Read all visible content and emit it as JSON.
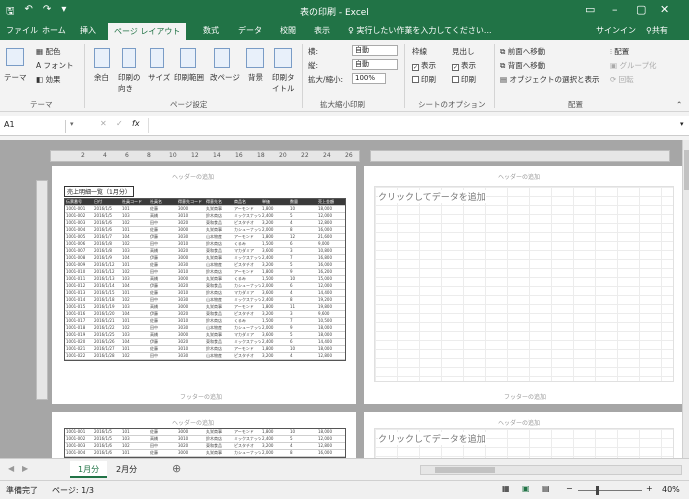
{
  "titlebar": {
    "title": "表の印刷 - Excel",
    "signin": "サインイン",
    "share": "共有"
  },
  "tabs": [
    {
      "label": "ファイル"
    },
    {
      "label": "ホーム"
    },
    {
      "label": "挿入"
    },
    {
      "label": "ページ レイアウト"
    },
    {
      "label": "数式"
    },
    {
      "label": "データ"
    },
    {
      "label": "校閲"
    },
    {
      "label": "表示"
    }
  ],
  "tell_me": "実行したい作業を入力してください...",
  "ribbon": {
    "theme": {
      "themes": "テーマ",
      "colors": "配色",
      "fonts": "フォント",
      "effects": "効果",
      "group": "テーマ"
    },
    "page_setup": {
      "margins": "余白",
      "orientation": "印刷の向き",
      "size": "サイズ",
      "print_area": "印刷範囲",
      "breaks": "改ページ",
      "background": "背景",
      "print_titles": "印刷タイトル",
      "group": "ページ設定"
    },
    "scale": {
      "width_label": "横:",
      "width_value": "自動",
      "height_label": "縦:",
      "height_value": "自動",
      "scale_label": "拡大/縮小:",
      "scale_value": "100%",
      "group": "拡大縮小印刷"
    },
    "sheet_options": {
      "gridlines": "枠線",
      "headings": "見出し",
      "view": "表示",
      "print": "印刷",
      "group": "シートのオプション"
    },
    "arrange": {
      "bring_forward": "前面へ移動",
      "send_backward": "背面へ移動",
      "selection_pane": "オブジェクトの選択と表示",
      "align": "配置",
      "group_btn": "グループ化",
      "rotate": "回転",
      "group": "配置"
    }
  },
  "formula_bar": {
    "name_box": "A1",
    "fx": "fx",
    "cancel": "✕",
    "enter": "✓",
    "value": ""
  },
  "ruler_numbers": [
    "2",
    "4",
    "6",
    "8",
    "10",
    "12",
    "14",
    "16",
    "18",
    "20",
    "22",
    "24",
    "26"
  ],
  "pages": {
    "header_text": "ヘッダーの追加",
    "footer_text": "フッターの追加",
    "click_to_add": "クリックしてデータを追加",
    "sheet_title": "売上明細一覧（1月分）"
  },
  "table_columns": [
    "伝票番号",
    "日付",
    "社員コード",
    "社員名",
    "得意先コード",
    "得意先名",
    "商品名",
    "単価",
    "数量",
    "売上金額"
  ],
  "table_rows": [
    [
      "1001-001",
      "2016/1/5",
      "101",
      "佐藤",
      "3000",
      "丸栄商事",
      "アーモンド",
      "1,800",
      "10",
      "18,000"
    ],
    [
      "1001-002",
      "2016/1/5",
      "103",
      "高橋",
      "3010",
      "鈴木商店",
      "ミックスナッツ",
      "2,400",
      "5",
      "12,000"
    ],
    [
      "1001-003",
      "2016/1/6",
      "102",
      "田中",
      "3020",
      "東和食品",
      "ピスタチオ",
      "3,200",
      "4",
      "12,800"
    ],
    [
      "1001-004",
      "2016/1/6",
      "101",
      "佐藤",
      "3000",
      "丸栄商事",
      "カシューナッツ",
      "2,000",
      "8",
      "16,000"
    ],
    [
      "1001-005",
      "2016/1/7",
      "104",
      "伊藤",
      "3030",
      "山本物産",
      "アーモンド",
      "1,800",
      "12",
      "21,600"
    ],
    [
      "1001-006",
      "2016/1/8",
      "102",
      "田中",
      "3010",
      "鈴木商店",
      "くるみ",
      "1,500",
      "6",
      "9,000"
    ],
    [
      "1001-007",
      "2016/1/8",
      "103",
      "高橋",
      "3020",
      "東和食品",
      "マカダミア",
      "3,600",
      "3",
      "10,800"
    ],
    [
      "1001-008",
      "2016/1/9",
      "104",
      "伊藤",
      "3000",
      "丸栄商事",
      "ミックスナッツ",
      "2,400",
      "7",
      "16,800"
    ],
    [
      "1001-009",
      "2016/1/12",
      "101",
      "佐藤",
      "3030",
      "山本物産",
      "ピスタチオ",
      "3,200",
      "5",
      "16,000"
    ],
    [
      "1001-010",
      "2016/1/12",
      "102",
      "田中",
      "3010",
      "鈴木商店",
      "アーモンド",
      "1,800",
      "9",
      "16,200"
    ],
    [
      "1001-011",
      "2016/1/13",
      "103",
      "高橋",
      "3000",
      "丸栄商事",
      "くるみ",
      "1,500",
      "10",
      "15,000"
    ],
    [
      "1001-012",
      "2016/1/14",
      "104",
      "伊藤",
      "3020",
      "東和食品",
      "カシューナッツ",
      "2,000",
      "6",
      "12,000"
    ],
    [
      "1001-013",
      "2016/1/15",
      "101",
      "佐藤",
      "3010",
      "鈴木商店",
      "マカダミア",
      "3,600",
      "4",
      "14,400"
    ],
    [
      "1001-014",
      "2016/1/18",
      "102",
      "田中",
      "3030",
      "山本物産",
      "ミックスナッツ",
      "2,400",
      "8",
      "19,200"
    ],
    [
      "1001-015",
      "2016/1/19",
      "103",
      "高橋",
      "3000",
      "丸栄商事",
      "アーモンド",
      "1,800",
      "11",
      "19,800"
    ],
    [
      "1001-016",
      "2016/1/20",
      "104",
      "伊藤",
      "3020",
      "東和食品",
      "ピスタチオ",
      "3,200",
      "3",
      "9,600"
    ],
    [
      "1001-017",
      "2016/1/21",
      "101",
      "佐藤",
      "3010",
      "鈴木商店",
      "くるみ",
      "1,500",
      "7",
      "10,500"
    ],
    [
      "1001-018",
      "2016/1/22",
      "102",
      "田中",
      "3030",
      "山本物産",
      "カシューナッツ",
      "2,000",
      "9",
      "18,000"
    ],
    [
      "1001-019",
      "2016/1/25",
      "103",
      "高橋",
      "3000",
      "丸栄商事",
      "マカダミア",
      "3,600",
      "5",
      "18,000"
    ],
    [
      "1001-020",
      "2016/1/26",
      "104",
      "伊藤",
      "3020",
      "東和食品",
      "ミックスナッツ",
      "2,400",
      "6",
      "14,400"
    ],
    [
      "1001-021",
      "2016/1/27",
      "101",
      "佐藤",
      "3010",
      "鈴木商店",
      "アーモンド",
      "1,800",
      "10",
      "18,000"
    ],
    [
      "1001-022",
      "2016/1/28",
      "102",
      "田中",
      "3030",
      "山本物産",
      "ピスタチオ",
      "3,200",
      "4",
      "12,800"
    ]
  ],
  "sheet_tabs": [
    {
      "label": "1月分"
    },
    {
      "label": "2月分"
    }
  ],
  "add_sheet": "⊕",
  "status": {
    "ready": "準備完了",
    "page": "ページ: 1/3",
    "zoom": "40%"
  },
  "colors": {
    "excel_green": "#217346"
  }
}
